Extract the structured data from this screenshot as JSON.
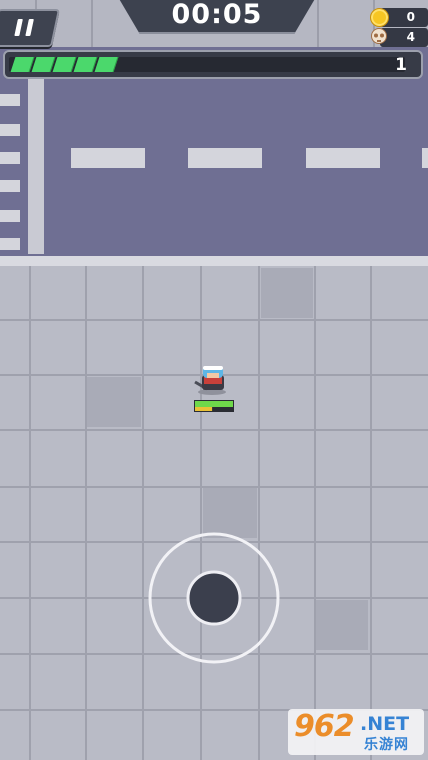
{
  "hud": {
    "timer": "00:05",
    "coins": "0",
    "kills": "4",
    "level": "1",
    "xp_fill": 0.3
  },
  "icons": [
    "pause-icon",
    "coin-icon",
    "skull-icon"
  ],
  "player_health": 1.0,
  "player_energy": 0.45,
  "watermark": {
    "brand": "962",
    "suffix": ".NET",
    "sub": "乐游网"
  },
  "colors": {
    "road": "#6f6f93",
    "tile": "#b9bbc6",
    "xp": "#4bd86c",
    "health": "#6fd84a",
    "hud_dark": "#3e4350"
  }
}
